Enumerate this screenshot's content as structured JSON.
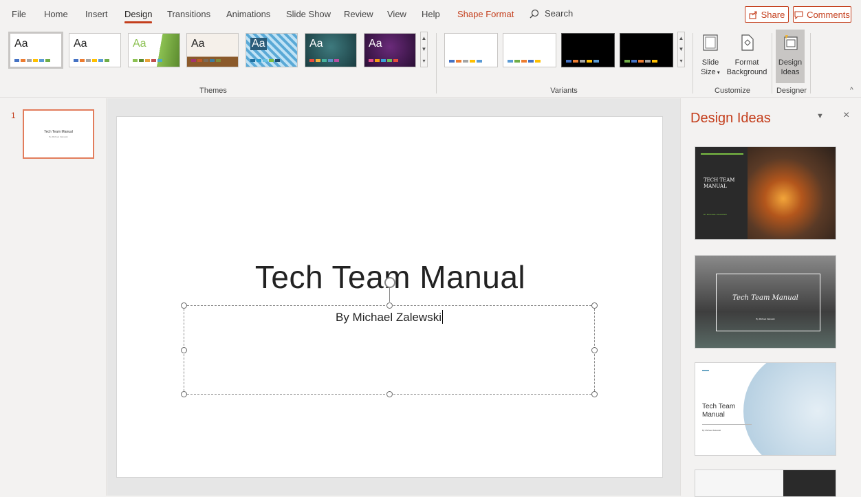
{
  "menu": {
    "tabs": [
      "File",
      "Home",
      "Insert",
      "Design",
      "Transitions",
      "Animations",
      "Slide Show",
      "Review",
      "View",
      "Help",
      "Shape Format"
    ],
    "active_tab": "Design",
    "search_label": "Search",
    "share_label": "Share",
    "comments_label": "Comments"
  },
  "ribbon": {
    "theme_sample": "Aa",
    "themes_label": "Themes",
    "variants_label": "Variants",
    "slide_size_label_1": "Slide",
    "slide_size_label_2": "Size",
    "format_bg_label_1": "Format",
    "format_bg_label_2": "Background",
    "design_ideas_label_1": "Design",
    "design_ideas_label_2": "Ideas",
    "customize_label": "Customize",
    "designer_label": "Designer"
  },
  "thumbnails": {
    "slide_number": "1",
    "thumb_title": "Tech Team Manual",
    "thumb_sub": "By Michael Zalewski"
  },
  "slide": {
    "title": "Tech Team Manual",
    "subtitle": "By Michael Zalewski"
  },
  "design_pane": {
    "title": "Design Ideas",
    "idea1_title_1": "TECH TEAM",
    "idea1_title_2": "MANUAL",
    "idea1_sub": "BY MICHAEL ZALEWSKI",
    "idea2_title": "Tech Team Manual",
    "idea2_sub": "By Michael Zalewski",
    "idea3_title_1": "Tech Team",
    "idea3_title_2": "Manual",
    "idea3_sub": "By Michael Zalewski"
  },
  "colors": {
    "accent": "#c43e1c",
    "selection": "#e27c5b"
  }
}
